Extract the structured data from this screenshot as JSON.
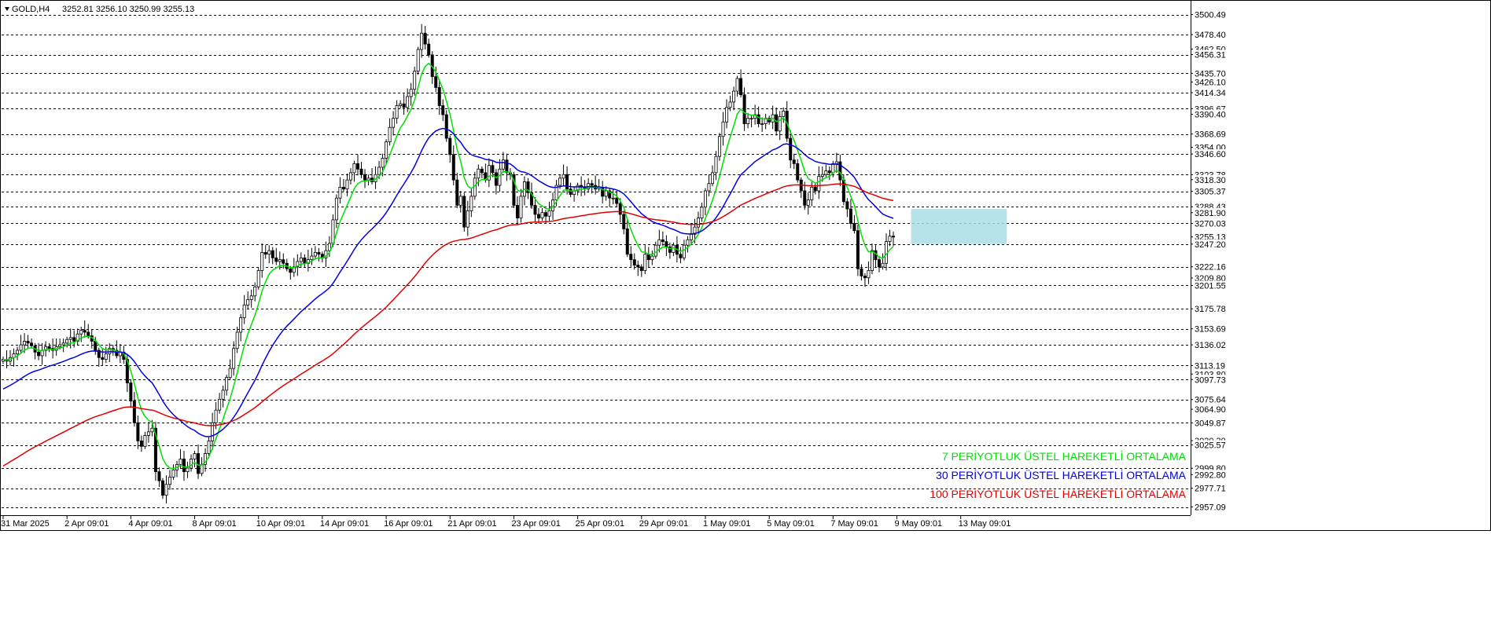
{
  "header": {
    "symbol": "GOLD,H4",
    "ohlc": "3252.81 3256.10 3250.99 3255.13",
    "menu_icon": "triangle-down-icon"
  },
  "colors": {
    "ema7": "#00e000",
    "ema30": "#0000e0",
    "ema100": "#e00000",
    "zone": "#a9dde6",
    "grid": "#000000",
    "candle_up": "#ffffff",
    "candle_down": "#000000"
  },
  "chart_data": {
    "type": "candlestick",
    "ylim": [
      2948,
      3514
    ],
    "grid": "horizontal-dashed",
    "price_labels": [
      {
        "id": "p3500",
        "value": 3500.49,
        "label": "3500.49",
        "line": true
      },
      {
        "id": "p3478",
        "value": 3478.4,
        "label": "3478.40",
        "line": true
      },
      {
        "id": "p3462",
        "value": 3462.5,
        "label": "3462.50",
        "line": false
      },
      {
        "id": "p3456",
        "value": 3456.31,
        "label": "3456.31",
        "line": true
      },
      {
        "id": "p3435",
        "value": 3435.7,
        "label": "3435.70",
        "line": true
      },
      {
        "id": "p3426",
        "value": 3426.1,
        "label": "3426.10",
        "line": false
      },
      {
        "id": "p3414",
        "value": 3414.34,
        "label": "3414.34",
        "line": true
      },
      {
        "id": "p3396",
        "value": 3396.67,
        "label": "3396.67",
        "line": true
      },
      {
        "id": "p3390",
        "value": 3390.4,
        "label": "3390.40",
        "line": false
      },
      {
        "id": "p3368",
        "value": 3368.69,
        "label": "3368.69",
        "line": true
      },
      {
        "id": "p3354",
        "value": 3354.0,
        "label": "3354.00",
        "line": false
      },
      {
        "id": "p3346",
        "value": 3346.6,
        "label": "3346.60",
        "line": true
      },
      {
        "id": "p3323",
        "value": 3323.78,
        "label": "3323.78",
        "line": true
      },
      {
        "id": "p3318",
        "value": 3318.3,
        "label": "3318.30",
        "line": false
      },
      {
        "id": "p3305",
        "value": 3305.37,
        "label": "3305.37",
        "line": true
      },
      {
        "id": "p3288",
        "value": 3288.43,
        "label": "3288.43",
        "line": true
      },
      {
        "id": "p3281",
        "value": 3281.9,
        "label": "3281.90",
        "line": false
      },
      {
        "id": "p3270",
        "value": 3270.03,
        "label": "3270.03",
        "line": true
      },
      {
        "id": "p3255",
        "value": 3255.13,
        "label": "3255.13",
        "line": false
      },
      {
        "id": "p3247",
        "value": 3247.2,
        "label": "3247.20",
        "line": true
      },
      {
        "id": "p3222",
        "value": 3222.16,
        "label": "3222.16",
        "line": true
      },
      {
        "id": "p3209",
        "value": 3209.8,
        "label": "3209.80",
        "line": false
      },
      {
        "id": "p3201",
        "value": 3201.55,
        "label": "3201.55",
        "line": true
      },
      {
        "id": "p3175",
        "value": 3175.78,
        "label": "3175.78",
        "line": true
      },
      {
        "id": "p3153",
        "value": 3153.69,
        "label": "3153.69",
        "line": true
      },
      {
        "id": "p3136",
        "value": 3136.02,
        "label": "3136.02",
        "line": true
      },
      {
        "id": "p3113",
        "value": 3113.19,
        "label": "3113.19",
        "line": true
      },
      {
        "id": "p3103",
        "value": 3103.8,
        "label": "3103.80",
        "line": false
      },
      {
        "id": "p3097",
        "value": 3097.73,
        "label": "3097.73",
        "line": true
      },
      {
        "id": "p3075",
        "value": 3075.64,
        "label": "3075.64",
        "line": true
      },
      {
        "id": "p3064",
        "value": 3064.9,
        "label": "3064.90",
        "line": false
      },
      {
        "id": "p3049",
        "value": 3049.87,
        "label": "3049.87",
        "line": true
      },
      {
        "id": "p3030",
        "value": 3030.3,
        "label": "3030.30",
        "line": false
      },
      {
        "id": "p3025",
        "value": 3025.57,
        "label": "3025.57",
        "line": true
      },
      {
        "id": "p2999",
        "value": 2999.8,
        "label": "2999.80",
        "line": true
      },
      {
        "id": "p2992",
        "value": 2992.8,
        "label": "2992.80",
        "line": false
      },
      {
        "id": "p2977",
        "value": 2977.71,
        "label": "2977.71",
        "line": true
      },
      {
        "id": "p2957",
        "value": 2957.09,
        "label": "2957.09",
        "line": true
      }
    ],
    "x_labels": [
      {
        "label": "31 Mar 2025",
        "bar": 0
      },
      {
        "label": "2 Apr 09:01",
        "bar": 18
      },
      {
        "label": "4 Apr 09:01",
        "bar": 36
      },
      {
        "label": "8 Apr 09:01",
        "bar": 54
      },
      {
        "label": "10 Apr 09:01",
        "bar": 72
      },
      {
        "label": "14 Apr 09:01",
        "bar": 90
      },
      {
        "label": "16 Apr 09:01",
        "bar": 108
      },
      {
        "label": "21 Apr 09:01",
        "bar": 126
      },
      {
        "label": "23 Apr 09:01",
        "bar": 144
      },
      {
        "label": "25 Apr 09:01",
        "bar": 162
      },
      {
        "label": "29 Apr 09:01",
        "bar": 180
      },
      {
        "label": "1 May 09:01",
        "bar": 198
      },
      {
        "label": "5 May 09:01",
        "bar": 216
      },
      {
        "label": "7 May 09:01",
        "bar": 234
      },
      {
        "label": "9 May 09:01",
        "bar": 252
      },
      {
        "label": "13 May 09:01",
        "bar": 270
      }
    ],
    "close_prices": [
      3120,
      3118,
      3122,
      3126,
      3130,
      3136,
      3140,
      3138,
      3135,
      3128,
      3124,
      3130,
      3134,
      3132,
      3130,
      3134,
      3136,
      3138,
      3142,
      3144,
      3140,
      3148,
      3152,
      3150,
      3146,
      3140,
      3130,
      3122,
      3120,
      3126,
      3132,
      3130,
      3124,
      3128,
      3120,
      3094,
      3074,
      3050,
      3030,
      3024,
      3036,
      3040,
      3044,
      2996,
      2986,
      2970,
      2982,
      2990,
      2998,
      3004,
      3010,
      2996,
      3000,
      3010,
      3016,
      2994,
      3004,
      3016,
      3030,
      3050,
      3064,
      3076,
      3086,
      3100,
      3110,
      3132,
      3150,
      3166,
      3180,
      3186,
      3190,
      3200,
      3218,
      3238,
      3236,
      3240,
      3232,
      3228,
      3230,
      3226,
      3220,
      3216,
      3222,
      3228,
      3232,
      3226,
      3230,
      3234,
      3238,
      3236,
      3232,
      3240,
      3248,
      3274,
      3298,
      3310,
      3308,
      3318,
      3326,
      3336,
      3330,
      3324,
      3318,
      3320,
      3316,
      3324,
      3332,
      3342,
      3360,
      3376,
      3386,
      3400,
      3402,
      3398,
      3410,
      3418,
      3438,
      3462,
      3480,
      3468,
      3456,
      3432,
      3420,
      3400,
      3390,
      3364,
      3346,
      3318,
      3290,
      3300,
      3266,
      3284,
      3300,
      3320,
      3330,
      3326,
      3318,
      3334,
      3326,
      3312,
      3330,
      3340,
      3326,
      3324,
      3290,
      3276,
      3300,
      3316,
      3304,
      3290,
      3280,
      3276,
      3282,
      3278,
      3284,
      3296,
      3312,
      3320,
      3324,
      3308,
      3302,
      3306,
      3312,
      3310,
      3308,
      3314,
      3312,
      3308,
      3310,
      3300,
      3306,
      3298,
      3298,
      3292,
      3280,
      3264,
      3236,
      3230,
      3224,
      3222,
      3218,
      3236,
      3230,
      3234,
      3246,
      3252,
      3250,
      3244,
      3238,
      3246,
      3236,
      3232,
      3246,
      3252,
      3258,
      3266,
      3276,
      3288,
      3306,
      3314,
      3326,
      3344,
      3366,
      3382,
      3398,
      3404,
      3416,
      3430,
      3412,
      3380,
      3386,
      3386,
      3390,
      3380,
      3380,
      3386,
      3382,
      3390,
      3372,
      3388,
      3394,
      3364,
      3340,
      3336,
      3318,
      3306,
      3290,
      3296,
      3310,
      3306,
      3322,
      3324,
      3328,
      3326,
      3336,
      3338,
      3318,
      3294,
      3286,
      3270,
      3262,
      3220,
      3212,
      3210,
      3218,
      3240,
      3230,
      3222,
      3226,
      3250,
      3256,
      3255
    ],
    "ema_series": [
      {
        "name": "7 PERİYOTLUK ÜSTEL HAREKETLİ ORTALAMA",
        "color": "#00e000",
        "period": 7
      },
      {
        "name": "30 PERİYOTLUK ÜSTEL HAREKETLİ ORTALAMA",
        "color": "#0000e0",
        "period": 30
      },
      {
        "name": "100 PERİYOTLUK ÜSTEL HAREKETLİ ORTALAMA",
        "color": "#e00000",
        "period": 100
      }
    ],
    "zone": {
      "from_bar": 256,
      "to_bar": 283,
      "low": 3247.2,
      "high": 3286.0
    }
  }
}
